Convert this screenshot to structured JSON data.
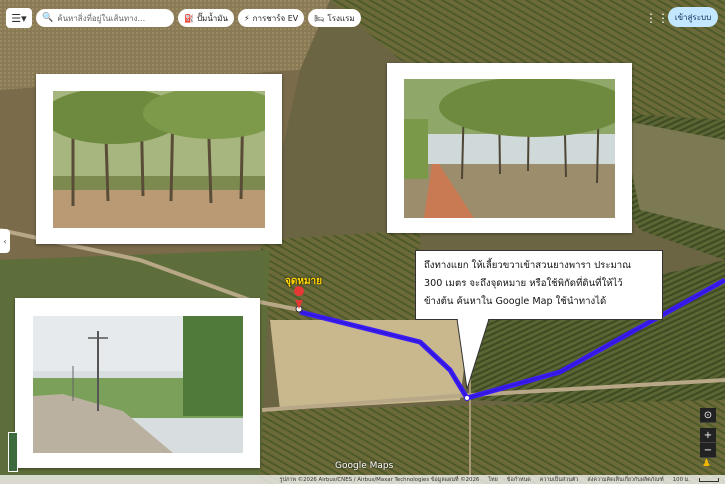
{
  "toolbar": {
    "search_placeholder": "ค้นหาสิ่งที่อยู่ในเส้นทาง...",
    "chips": [
      {
        "icon": "fuel-icon",
        "glyph": "⛽",
        "label": "ปั๊มน้ำมัน"
      },
      {
        "icon": "ev-charger-icon",
        "glyph": "⚡",
        "label": "การชาร์จ EV"
      },
      {
        "icon": "hotel-icon",
        "glyph": "🛏",
        "label": "โรงแรม"
      }
    ],
    "signin_label": "เข้าสู่ระบบ"
  },
  "map": {
    "destination_label": "จุดหมาย",
    "route_color": "#3b1cf5",
    "pin_color": "#e53935",
    "callout_lines": [
      "ถึงทางแยก ให้เลี้ยวขวาเข้าสวนยางพารา ประมาณ",
      "300 เมตร จะถึงจุดหมาย หรือใช้พิกัดที่ดินที่ให้ไว้",
      "ข้างต้น ค้นหาใน Google Map ใช้นำทางได้"
    ]
  },
  "controls": {
    "zoom_in": "+",
    "zoom_out": "−",
    "locate_glyph": "⊙"
  },
  "attribution": {
    "logo": "Google Maps",
    "imagery": "รูปภาพ ©2026 Airbus/CNES / Airbus/Maxar Technologies ข้อมูลแผนที่ ©2026",
    "links": [
      "ไทย",
      "ข้อกำหนด",
      "ความเป็นส่วนตัว",
      "ส่งความคิดเห็นเกี่ยวกับผลิตภัณฑ์"
    ],
    "scale": "100 ม."
  }
}
